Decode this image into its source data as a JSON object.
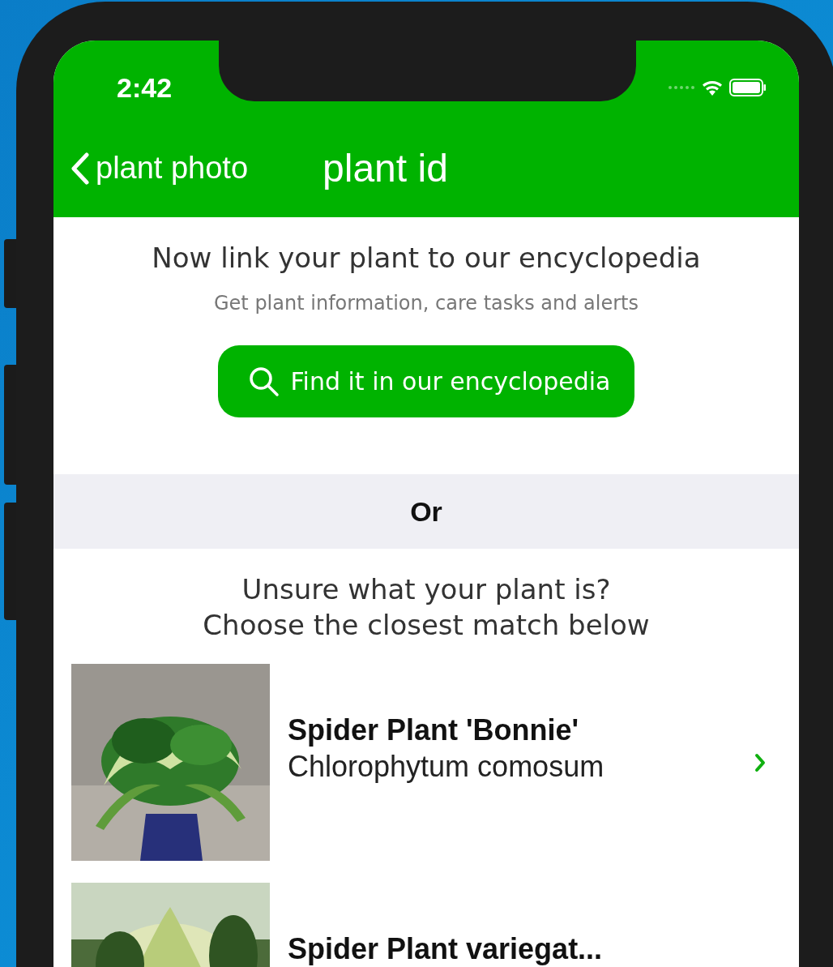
{
  "status_bar": {
    "time": "2:42"
  },
  "nav": {
    "back": "plant photo",
    "title": "plant id"
  },
  "intro": {
    "heading": "Now link your plant to our encyclopedia",
    "subheading": "Get plant information, care tasks and alerts",
    "button": "Find it in our encyclopedia"
  },
  "divider": "Or",
  "prompt": [
    "Unsure what your plant is?",
    "Choose the closest match below"
  ],
  "results": [
    {
      "name": "Spider Plant 'Bonnie'",
      "latin": "Chlorophytum comosum",
      "kind": "picture"
    },
    {
      "name": "Spider Plant variegat...",
      "kind": "picture"
    }
  ]
}
